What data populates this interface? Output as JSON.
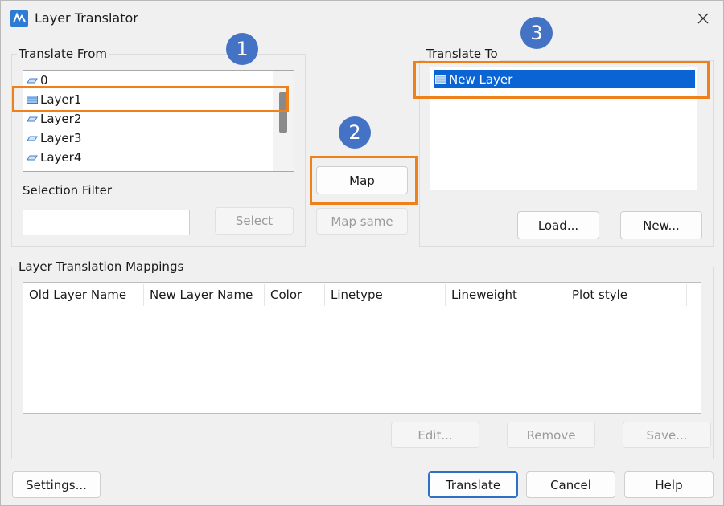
{
  "window": {
    "title": "Layer Translator"
  },
  "translate_from": {
    "label": "Translate From",
    "items": [
      "0",
      "Layer1",
      "Layer2",
      "Layer3",
      "Layer4"
    ],
    "selection_filter_label": "Selection Filter",
    "selection_filter_value": "",
    "select_button": "Select"
  },
  "middle": {
    "map_button": "Map",
    "map_same_button": "Map same"
  },
  "translate_to": {
    "label": "Translate To",
    "items": [
      "New Layer"
    ],
    "load_button": "Load...",
    "new_button": "New..."
  },
  "mappings": {
    "label": "Layer Translation Mappings",
    "columns": [
      "Old Layer Name",
      "New Layer Name",
      "Color",
      "Linetype",
      "Lineweight",
      "Plot style"
    ],
    "edit_button": "Edit...",
    "remove_button": "Remove",
    "save_button": "Save..."
  },
  "footer": {
    "settings_button": "Settings...",
    "translate_button": "Translate",
    "cancel_button": "Cancel",
    "help_button": "Help"
  },
  "badges": [
    "1",
    "2",
    "3"
  ],
  "colors": {
    "accent": "#4472c4",
    "highlight": "#f0801a",
    "selection": "#0a64d4"
  },
  "icons": {
    "app": "layer-translator-icon",
    "close": "close-icon",
    "layer": "layer-icon"
  }
}
